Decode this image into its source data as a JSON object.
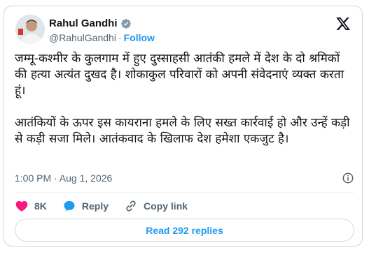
{
  "author": {
    "name": "Rahul Gandhi",
    "handle": "@RahulGandhi",
    "separator": "·",
    "follow_label": "Follow"
  },
  "tweet": {
    "paragraphs": [
      "जम्मू-कश्मीर के कुलगाम में हुए दुस्साहसी आतंकी हमले में देश के दो श्रमिकों की हत्या अत्यंत दुखद है। शोकाकुल परिवारों को अपनी संवेदनाएं व्यक्त करता हूं।",
      "आतंकियों के ऊपर इस कायराना हमले के लिए सख्त कार्रवाई हो और उन्हें कड़ी से कड़ी सजा मिले। आतंकवाद के खिलाफ देश हमेशा एकजुट है।"
    ],
    "timestamp": "1:00 PM · Aug 1, 2026"
  },
  "actions": {
    "likes": "8K",
    "reply_label": "Reply",
    "copy_link_label": "Copy link"
  },
  "read_replies_label": "Read 292 replies",
  "colors": {
    "accent": "#1d9bf0",
    "like": "#f91880",
    "text": "#0f1419",
    "muted": "#536471",
    "border": "#cfd9de"
  },
  "icons": [
    "avatar",
    "verified-badge-icon",
    "x-logo-icon",
    "info-icon",
    "heart-icon",
    "reply-bubble-icon",
    "link-icon"
  ]
}
